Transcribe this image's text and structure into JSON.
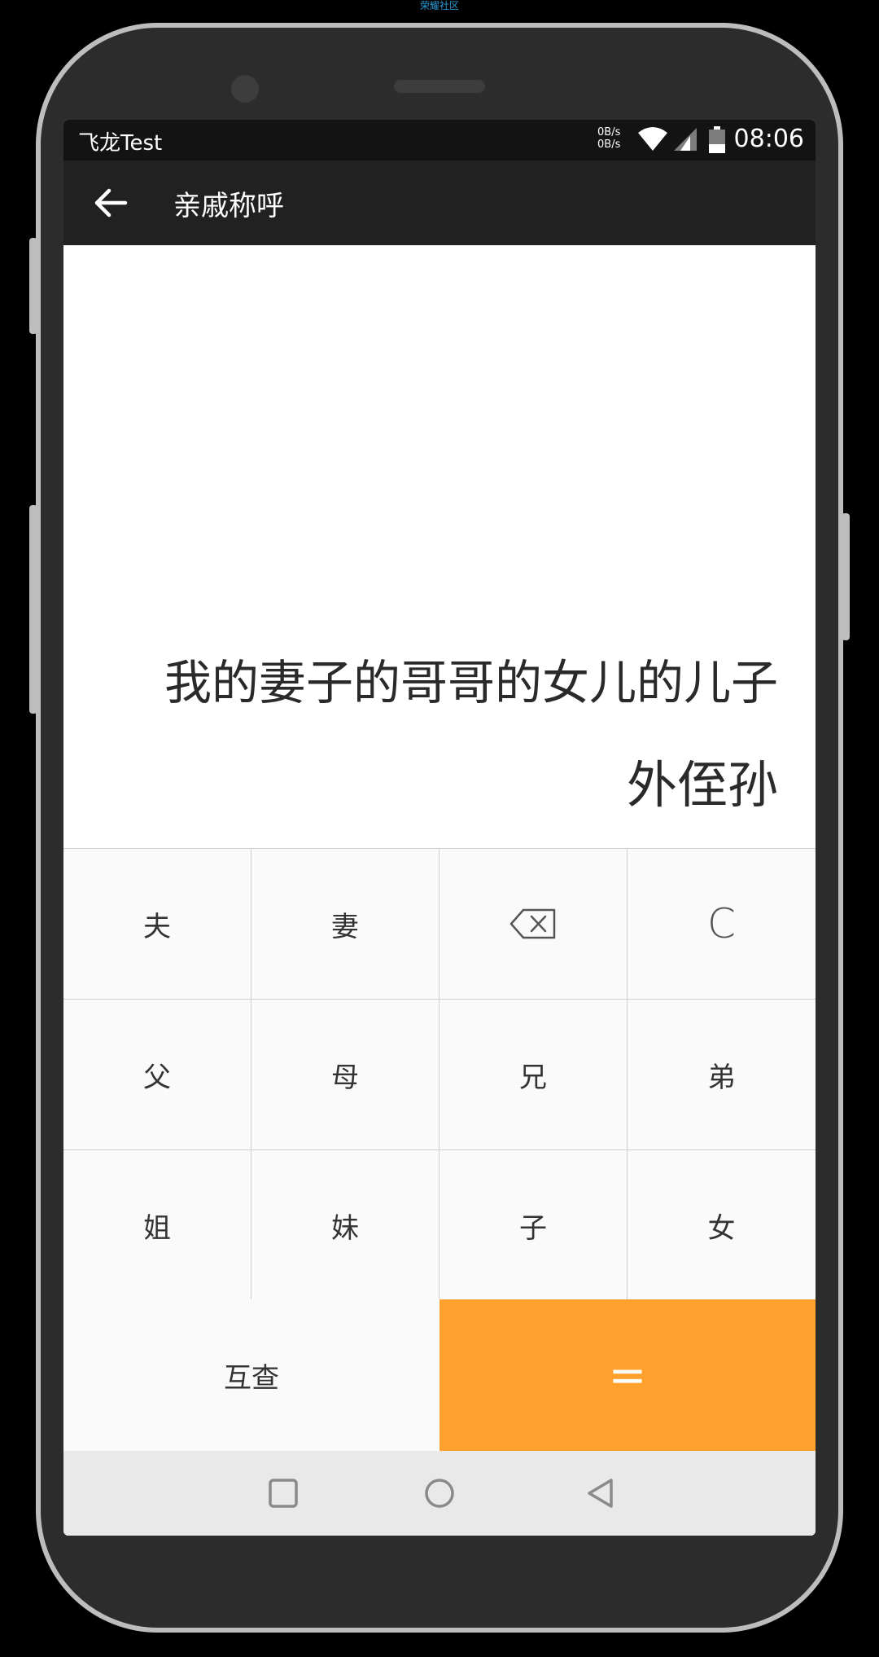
{
  "watermark": "荣耀社区",
  "status_bar": {
    "carrier": "飞龙Test",
    "net_up": "0B/s",
    "net_down": "0B/s",
    "time": "08:06"
  },
  "app_bar": {
    "title": "亲戚称呼"
  },
  "display": {
    "expression": "我的妻子的哥哥的女儿的儿子",
    "result": "外侄孙"
  },
  "keypad": {
    "keys": [
      {
        "label": "夫",
        "name": "key-husband"
      },
      {
        "label": "妻",
        "name": "key-wife"
      },
      {
        "label": "",
        "name": "backspace-button",
        "icon": "backspace-icon"
      },
      {
        "label": "C",
        "name": "clear-button"
      },
      {
        "label": "父",
        "name": "key-father"
      },
      {
        "label": "母",
        "name": "key-mother"
      },
      {
        "label": "兄",
        "name": "key-elder-brother"
      },
      {
        "label": "弟",
        "name": "key-younger-brother"
      },
      {
        "label": "姐",
        "name": "key-elder-sister"
      },
      {
        "label": "妹",
        "name": "key-younger-sister"
      },
      {
        "label": "子",
        "name": "key-son"
      },
      {
        "label": "女",
        "name": "key-daughter"
      }
    ],
    "compare_label": "互查",
    "equals_label": "="
  },
  "colors": {
    "accent": "#ffa12c",
    "app_bar": "#212121",
    "status_bar": "#131313"
  },
  "icons": {
    "back": "arrow-left-icon",
    "backspace": "backspace-icon",
    "nav_recent": "square-icon",
    "nav_home": "circle-icon",
    "nav_back": "triangle-back-icon"
  }
}
